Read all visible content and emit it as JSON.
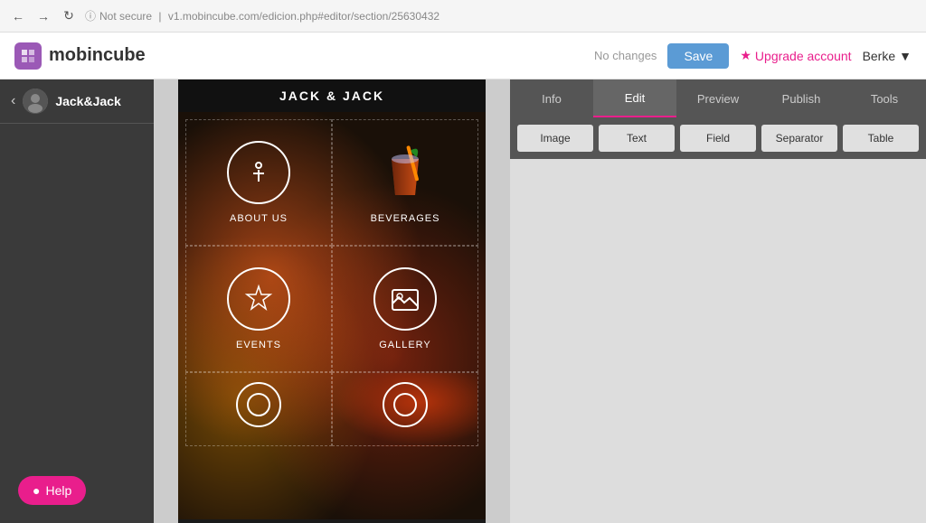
{
  "browser": {
    "secure_label": "Not secure",
    "url": "v1.mobincube.com/edicion.php#editor/section/25630432"
  },
  "topnav": {
    "logo_text": "mobincube",
    "no_changes_label": "No changes",
    "save_label": "Save",
    "upgrade_label": "Upgrade account",
    "user_name": "Berke"
  },
  "sidebar": {
    "site_name": "Jack&Jack"
  },
  "mobile": {
    "title": "JACK & JACK",
    "items": [
      {
        "id": "about-us",
        "label": "ABOUT US",
        "icon": "info"
      },
      {
        "id": "beverages",
        "label": "BEVERAGES",
        "icon": "beverage"
      },
      {
        "id": "events",
        "label": "EVENTS",
        "icon": "star"
      },
      {
        "id": "gallery",
        "label": "GALLERY",
        "icon": "image"
      },
      {
        "id": "item5",
        "label": "",
        "icon": "circle"
      },
      {
        "id": "item6",
        "label": "",
        "icon": "circle2"
      }
    ]
  },
  "panel": {
    "tabs": [
      {
        "id": "info",
        "label": "Info"
      },
      {
        "id": "edit",
        "label": "Edit"
      },
      {
        "id": "preview",
        "label": "Preview"
      },
      {
        "id": "publish",
        "label": "Publish"
      },
      {
        "id": "tools",
        "label": "Tools"
      }
    ],
    "active_tab": "Edit",
    "element_buttons": [
      {
        "id": "image",
        "label": "Image"
      },
      {
        "id": "text",
        "label": "Text"
      },
      {
        "id": "field",
        "label": "Field"
      },
      {
        "id": "separator",
        "label": "Separator"
      },
      {
        "id": "table",
        "label": "Table"
      }
    ]
  },
  "help": {
    "label": "Help"
  }
}
